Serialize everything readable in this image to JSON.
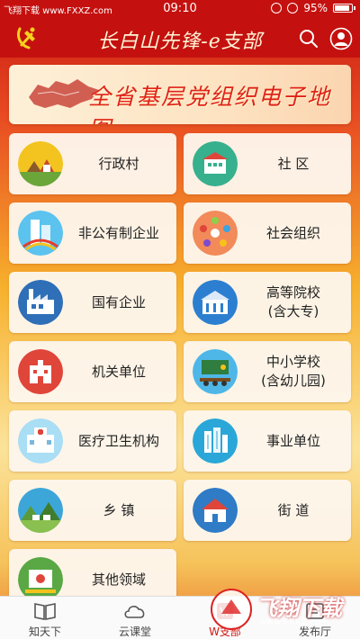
{
  "statusbar": {
    "watermark": "飞翔下载 www.FXXZ.com",
    "time": "09:10",
    "battery": "95%"
  },
  "header": {
    "title": "长白山先锋-e支部",
    "icons": {
      "left": "party-emblem-icon",
      "search": "search-icon",
      "user": "user-icon"
    }
  },
  "banner": {
    "text": "全省基层党组织电子地图"
  },
  "grid": {
    "items": [
      {
        "line1": "行政村",
        "line2": "",
        "icon": "village-icon"
      },
      {
        "line1": "社 区",
        "line2": "",
        "icon": "community-icon"
      },
      {
        "line1": "非公有制企业",
        "line2": "",
        "icon": "private-enterprise-icon"
      },
      {
        "line1": "社会组织",
        "line2": "",
        "icon": "social-org-icon"
      },
      {
        "line1": "国有企业",
        "line2": "",
        "icon": "state-enterprise-icon"
      },
      {
        "line1": "高等院校",
        "line2": "(含大专)",
        "icon": "university-icon"
      },
      {
        "line1": "机关单位",
        "line2": "",
        "icon": "government-icon"
      },
      {
        "line1": "中小学校",
        "line2": "(含幼儿园)",
        "icon": "school-icon"
      },
      {
        "line1": "医疗卫生机构",
        "line2": "",
        "icon": "hospital-icon"
      },
      {
        "line1": "事业单位",
        "line2": "",
        "icon": "public-institution-icon"
      },
      {
        "line1": "乡 镇",
        "line2": "",
        "icon": "township-icon"
      },
      {
        "line1": "街 道",
        "line2": "",
        "icon": "street-icon"
      },
      {
        "line1": "其他领域",
        "line2": "",
        "icon": "other-icon"
      }
    ]
  },
  "bottomnav": {
    "items": [
      {
        "label": "知天下",
        "icon": "book-icon"
      },
      {
        "label": "云课堂",
        "icon": "cloud-icon"
      },
      {
        "label": "W支部",
        "icon": "branch-icon"
      },
      {
        "label": "发布厅",
        "icon": "publish-icon"
      }
    ],
    "active_index": 2
  },
  "watermark": {
    "text": "飞翔下载",
    "url": "www.FXXZ.com"
  },
  "colors": {
    "brand_red": "#c4110f",
    "card_bg": "#fdf6ec",
    "active_nav": "#d11a14"
  }
}
